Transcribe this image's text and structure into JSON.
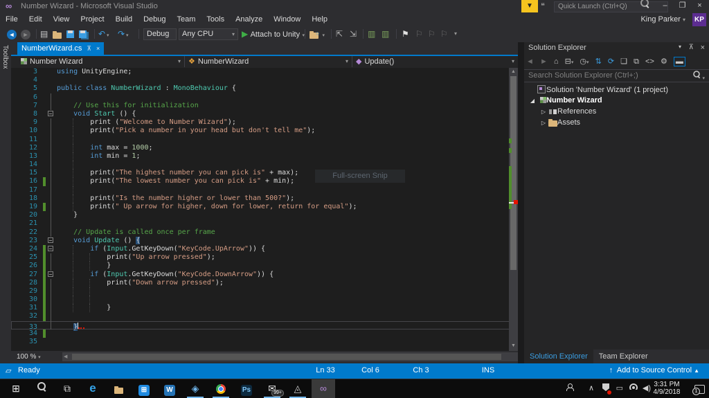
{
  "window": {
    "title": "Number Wizard - Microsoft Visual Studio"
  },
  "titlebar": {
    "quick_launch_placeholder": "Quick Launch (Ctrl+Q)",
    "user_name": "King Parker",
    "user_initials": "KP",
    "minimize": "–",
    "restore": "❐",
    "close": "×"
  },
  "menu": {
    "items": [
      "File",
      "Edit",
      "View",
      "Project",
      "Build",
      "Debug",
      "Team",
      "Tools",
      "Analyze",
      "Window",
      "Help"
    ]
  },
  "toolbar": {
    "debug_target": "Debug",
    "platform": "Any CPU",
    "attach_label": "Attach to Unity"
  },
  "editor": {
    "tab_label": "NumberWizard.cs",
    "toolbox_label": "Toolbox",
    "breadcrumbs": {
      "project": "Number Wizard",
      "type": "NumberWizard",
      "member": "Update()"
    },
    "zoom_level": "100 %",
    "overlay_text": "Full-screen Snip",
    "code": {
      "lines": [
        {
          "n": 3,
          "i": 0,
          "toks": [
            [
              "k",
              "using"
            ],
            [
              "p",
              " UnityEngine;"
            ]
          ]
        },
        {
          "n": 4,
          "i": 0,
          "toks": []
        },
        {
          "n": 5,
          "i": 0,
          "toks": [
            [
              "k",
              "public"
            ],
            [
              "p",
              " "
            ],
            [
              "k",
              "class"
            ],
            [
              "p",
              " "
            ],
            [
              "t",
              "NumberWizard"
            ],
            [
              "p",
              " : "
            ],
            [
              "t",
              "MonoBehaviour"
            ],
            [
              "p",
              " {"
            ]
          ]
        },
        {
          "n": 6,
          "i": 0,
          "fv": 1,
          "toks": []
        },
        {
          "n": 7,
          "i": 1,
          "fv": 1,
          "toks": [
            [
              "c",
              "// Use this for initialization"
            ]
          ]
        },
        {
          "n": 8,
          "i": 1,
          "fold": 1,
          "toks": [
            [
              "k",
              "void"
            ],
            [
              "p",
              " "
            ],
            [
              "t",
              "Start"
            ],
            [
              "p",
              " () {"
            ]
          ]
        },
        {
          "n": 9,
          "i": 2,
          "fv": 1,
          "toks": [
            [
              "p",
              "print ("
            ],
            [
              "s",
              "\"Welcome to Number Wizard\""
            ],
            [
              "p",
              ");"
            ]
          ]
        },
        {
          "n": 10,
          "i": 2,
          "fv": 1,
          "toks": [
            [
              "p",
              "print("
            ],
            [
              "s",
              "\"Pick a number in your head but don't tell me\""
            ],
            [
              "p",
              ");"
            ]
          ]
        },
        {
          "n": 11,
          "i": 2,
          "fv": 1,
          "toks": []
        },
        {
          "n": 12,
          "i": 2,
          "fv": 1,
          "toks": [
            [
              "k",
              "int"
            ],
            [
              "p",
              " max = "
            ],
            [
              "n_",
              "1000"
            ],
            [
              "p",
              ";"
            ]
          ]
        },
        {
          "n": 13,
          "i": 2,
          "fv": 1,
          "toks": [
            [
              "k",
              "int"
            ],
            [
              "p",
              " min = "
            ],
            [
              "n_",
              "1"
            ],
            [
              "p",
              ";"
            ]
          ]
        },
        {
          "n": 14,
          "i": 2,
          "fv": 1,
          "toks": []
        },
        {
          "n": 15,
          "i": 2,
          "fv": 1,
          "toks": [
            [
              "p",
              "print("
            ],
            [
              "s",
              "\"The highest number you can pick is\""
            ],
            [
              "p",
              " + max);"
            ]
          ]
        },
        {
          "n": 16,
          "i": 2,
          "fv": 1,
          "cb": 1,
          "toks": [
            [
              "p",
              "print("
            ],
            [
              "s",
              "\"The lowest number you can pick is\""
            ],
            [
              "p",
              " + min);"
            ]
          ]
        },
        {
          "n": 17,
          "i": 2,
          "fv": 1,
          "toks": []
        },
        {
          "n": 18,
          "i": 2,
          "fv": 1,
          "toks": [
            [
              "p",
              "print("
            ],
            [
              "s",
              "\"Is the number higher or lower than 500?\""
            ],
            [
              "p",
              ");"
            ]
          ]
        },
        {
          "n": 19,
          "i": 2,
          "fv": 1,
          "cb": 1,
          "toks": [
            [
              "p",
              "print("
            ],
            [
              "s",
              "\" Up arrow for higher, down for lower, return for equal\""
            ],
            [
              "p",
              ");"
            ]
          ]
        },
        {
          "n": 20,
          "i": 1,
          "fv": 1,
          "toks": [
            [
              "p",
              "}"
            ]
          ]
        },
        {
          "n": 21,
          "i": 1,
          "fv": 1,
          "toks": []
        },
        {
          "n": 22,
          "i": 1,
          "fv": 1,
          "toks": [
            [
              "c",
              "// Update is called once per frame"
            ]
          ]
        },
        {
          "n": 23,
          "i": 1,
          "fold": 1,
          "toks": [
            [
              "k",
              "void"
            ],
            [
              "p",
              " "
            ],
            [
              "t",
              "Update"
            ],
            [
              "p",
              " () "
            ],
            [
              "b",
              "{"
            ]
          ]
        },
        {
          "n": 24,
          "i": 2,
          "fold": 1,
          "cb": 1,
          "toks": [
            [
              "k",
              "if"
            ],
            [
              "p",
              " ("
            ],
            [
              "t",
              "Input"
            ],
            [
              "p",
              ".GetKeyDown("
            ],
            [
              "s",
              "\"KeyCode.UpArrow\""
            ],
            [
              "p",
              ")) {"
            ]
          ]
        },
        {
          "n": 25,
          "i": 3,
          "fv": 1,
          "cb": 1,
          "toks": [
            [
              "p",
              "print("
            ],
            [
              "s",
              "\"Up arrow pressed\""
            ],
            [
              "p",
              ");"
            ]
          ]
        },
        {
          "n": 26,
          "i": 3,
          "fv": 1,
          "cb": 1,
          "toks": [
            [
              "p",
              "}"
            ]
          ]
        },
        {
          "n": 27,
          "i": 2,
          "fold": 1,
          "cb": 1,
          "toks": [
            [
              "k",
              "if"
            ],
            [
              "p",
              " ("
            ],
            [
              "t",
              "Input"
            ],
            [
              "p",
              ".GetKeyDown("
            ],
            [
              "s",
              "\"KeyCode.DownArrow\""
            ],
            [
              "p",
              ")) {"
            ]
          ]
        },
        {
          "n": 28,
          "i": 3,
          "fv": 1,
          "cb": 1,
          "toks": [
            [
              "p",
              "print("
            ],
            [
              "s",
              "\"Down arrow pressed\""
            ],
            [
              "p",
              ");"
            ]
          ]
        },
        {
          "n": 29,
          "i": 3,
          "fv": 1,
          "cb": 1,
          "toks": []
        },
        {
          "n": 30,
          "i": 3,
          "fv": 1,
          "cb": 1,
          "toks": []
        },
        {
          "n": 31,
          "i": 3,
          "fv": 1,
          "cb": 1,
          "toks": [
            [
              "p",
              "}"
            ]
          ]
        },
        {
          "n": 32,
          "i": 1,
          "fv": 1,
          "cb": 1,
          "toks": []
        },
        {
          "n": 33,
          "i": 1,
          "fv": 1,
          "cur": 1,
          "caret": 1,
          "toks": [
            [
              "h",
              "}"
            ]
          ]
        },
        {
          "n": 34,
          "i": 0,
          "cb": 1,
          "toks": []
        },
        {
          "n": 35,
          "i": 0,
          "toks": []
        }
      ]
    }
  },
  "solution_explorer": {
    "title": "Solution Explorer",
    "search_placeholder": "Search Solution Explorer (Ctrl+;)",
    "tree": [
      {
        "label": "Solution 'Number Wizard' (1 project)",
        "icon": "solution",
        "level": 0,
        "expander": "none"
      },
      {
        "label": "Number Wizard",
        "icon": "unity-project",
        "level": 0,
        "expander": "open",
        "bold": 1
      },
      {
        "label": "References",
        "icon": "references",
        "level": 1,
        "expander": "closed"
      },
      {
        "label": "Assets",
        "icon": "folder",
        "level": 1,
        "expander": "closed"
      }
    ],
    "bottom_tabs": [
      {
        "label": "Solution Explorer",
        "active": 1
      },
      {
        "label": "Team Explorer",
        "active": 0
      }
    ]
  },
  "status_bar": {
    "ready": "Ready",
    "ln": "Ln 33",
    "col": "Col 6",
    "ch": "Ch 3",
    "ins": "INS",
    "source_control": "Add to Source Control"
  },
  "taskbar": {
    "apps": [
      {
        "name": "start-button",
        "kind": "glyph",
        "glyph": "⊞",
        "color": "#e8e8e8"
      },
      {
        "name": "search-icon",
        "kind": "mag"
      },
      {
        "name": "task-view-icon",
        "kind": "glyph",
        "glyph": "⧉",
        "color": "#d8d8d8"
      },
      {
        "name": "edge-icon",
        "kind": "glyph",
        "glyph": "e",
        "color": "#35a3e8",
        "big": 1
      },
      {
        "name": "file-explorer-icon",
        "kind": "folder"
      },
      {
        "name": "store-icon",
        "kind": "sq",
        "label": "⊞",
        "bg": "#1f8ae0",
        "color": "#fff"
      },
      {
        "name": "w-app-icon",
        "kind": "sq",
        "label": "W",
        "bg": "#2573b5",
        "color": "#fff"
      },
      {
        "name": "cube-app-icon",
        "kind": "glyph",
        "glyph": "◈",
        "color": "#6fb3e8",
        "underline": 1
      },
      {
        "name": "chrome-icon",
        "kind": "chrome",
        "underline": 1
      },
      {
        "name": "photoshop-icon",
        "kind": "sq",
        "label": "Ps",
        "bg": "#0d2a3f",
        "color": "#7fc4f5"
      },
      {
        "name": "mail-icon",
        "kind": "glyph",
        "glyph": "✉",
        "color": "#e8e8e8",
        "underline": 1,
        "badge": "99+"
      },
      {
        "name": "unity-icon",
        "kind": "glyph",
        "glyph": "◬",
        "color": "#c8c8c8",
        "underline": 1
      },
      {
        "name": "visual-studio-icon",
        "kind": "glyph",
        "glyph": "∞",
        "color": "#b489d6",
        "active": 1
      }
    ],
    "clock_time": "3:31 PM",
    "clock_date": "4/9/2018",
    "notification_badge": "1"
  }
}
